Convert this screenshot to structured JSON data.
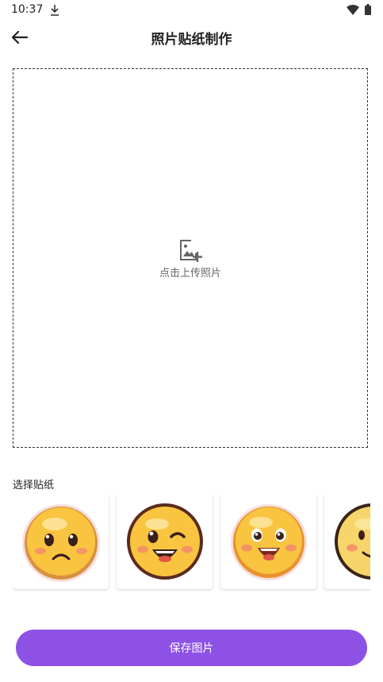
{
  "status_bar": {
    "time": "10:37",
    "icons": [
      "download-icon",
      "wifi-icon",
      "battery-icon"
    ]
  },
  "header": {
    "title": "照片贴纸制作",
    "back_icon": "arrow-left-icon"
  },
  "upload": {
    "label": "点击上传照片",
    "icon": "add-photo-icon"
  },
  "stickers": {
    "label": "选择贴纸",
    "items": [
      {
        "name": "sad-emoji"
      },
      {
        "name": "wink-emoji"
      },
      {
        "name": "happy-emoji"
      },
      {
        "name": "smile-emoji"
      }
    ]
  },
  "actions": {
    "save_label": "保存图片"
  },
  "colors": {
    "accent": "#8e51e6",
    "emoji_yellow": "#f9c440",
    "blush": "#f28b6b"
  }
}
